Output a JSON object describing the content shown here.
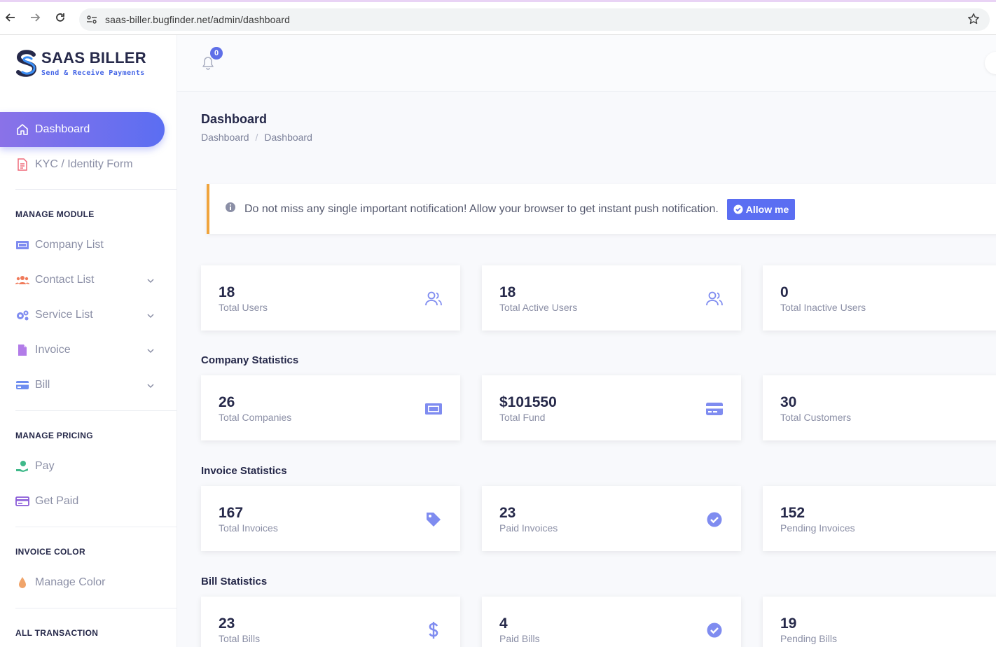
{
  "browser": {
    "url": "saas-biller.bugfinder.net/admin/dashboard"
  },
  "logo": {
    "title": "SAAS BILLER",
    "subtitle": "Send & Receive Payments"
  },
  "sidebar": {
    "dashboard": "Dashboard",
    "kyc": "KYC / Identity Form",
    "manage_module_heading": "MANAGE MODULE",
    "company_list": "Company List",
    "contact_list": "Contact List",
    "service_list": "Service List",
    "invoice": "Invoice",
    "bill": "Bill",
    "manage_pricing_heading": "MANAGE PRICING",
    "pay": "Pay",
    "get_paid": "Get Paid",
    "invoice_color_heading": "INVOICE COLOR",
    "manage_color": "Manage Color",
    "all_transaction_heading": "ALL TRANSACTION"
  },
  "topbar": {
    "notification_count": "0"
  },
  "page": {
    "title": "Dashboard",
    "breadcrumb": [
      "Dashboard",
      "Dashboard"
    ]
  },
  "notice": {
    "text": "Do not miss any single important notification! Allow your browser to get instant push notification.",
    "button": "Allow me"
  },
  "users": [
    {
      "value": "18",
      "label": "Total Users",
      "icon": "users-icon"
    },
    {
      "value": "18",
      "label": "Total Active Users",
      "icon": "users-icon"
    },
    {
      "value": "0",
      "label": "Total Inactive Users",
      "icon": "users-icon"
    }
  ],
  "company_stats": {
    "title": "Company Statistics",
    "cards": [
      {
        "value": "26",
        "label": "Total Companies",
        "icon": "ticket-icon"
      },
      {
        "value": "$101550",
        "label": "Total Fund",
        "icon": "credit-card-icon"
      },
      {
        "value": "30",
        "label": "Total Customers",
        "icon": "user-icon"
      }
    ]
  },
  "invoice_stats": {
    "title": "Invoice Statistics",
    "cards": [
      {
        "value": "167",
        "label": "Total Invoices",
        "icon": "tag-icon"
      },
      {
        "value": "23",
        "label": "Paid Invoices",
        "icon": "check-circle-icon"
      },
      {
        "value": "152",
        "label": "Pending Invoices",
        "icon": "spinner-icon"
      }
    ]
  },
  "bill_stats": {
    "title": "Bill Statistics",
    "cards": [
      {
        "value": "23",
        "label": "Total Bills",
        "icon": "dollar-icon"
      },
      {
        "value": "4",
        "label": "Paid Bills",
        "icon": "check-circle-icon"
      },
      {
        "value": "19",
        "label": "Pending Bills",
        "icon": "spinner-icon"
      }
    ]
  },
  "colors": {
    "accent": "#5b6ef2",
    "gradient_start": "#8a72e8",
    "notice_border": "#f0a43c",
    "card_icon": "#7f8cf0"
  }
}
